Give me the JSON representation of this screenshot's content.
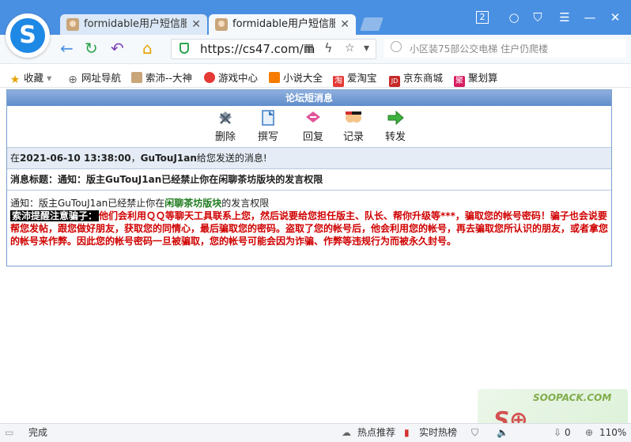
{
  "browser": {
    "tabs": [
      {
        "title": "formidable用户短信服务",
        "close": "✕",
        "active": false
      },
      {
        "title": "formidable用户短信服务",
        "close": "✕",
        "active": true
      }
    ],
    "window_controls": {
      "count": "2",
      "tshirt": "👕",
      "menu": "☰",
      "minimize": "—",
      "maximize": "☐",
      "close": "✕"
    },
    "nav": {
      "back": "←",
      "reload": "↻",
      "undo": "↶",
      "home": "⌂"
    },
    "address": {
      "url": "https://cs47.com/m",
      "qr": "▦",
      "bolt": "ϟ",
      "dropdown": "▾"
    },
    "search": {
      "placeholder": "小区装75部公交电梯 住户仍爬楼"
    }
  },
  "bookmarks": [
    {
      "label": "收藏",
      "icon": "star-icon"
    },
    {
      "label": "网址导航",
      "icon": "globe-icon"
    },
    {
      "label": "索沛--大神",
      "icon": "avatar-icon"
    },
    {
      "label": "游戏中心",
      "icon": "game-icon"
    },
    {
      "label": "小说大全",
      "icon": "book-icon"
    },
    {
      "label": "爱淘宝",
      "icon": "taobao-icon"
    },
    {
      "label": "京东商城",
      "icon": "jd-icon"
    },
    {
      "label": "聚划算",
      "icon": "juhuasuan-icon"
    }
  ],
  "bookmark_glyphs": {
    "taobao": "淘",
    "jd": "JD",
    "ju": "聚",
    "star": "★",
    "globe": "⊕"
  },
  "message": {
    "header": "论坛短消息",
    "tools": [
      {
        "label": "删除",
        "icon": "delete-icon"
      },
      {
        "label": "撰写",
        "icon": "compose-icon"
      },
      {
        "label": "回复",
        "icon": "reply-icon"
      },
      {
        "label": "记录",
        "icon": "record-icon"
      },
      {
        "label": "转发",
        "icon": "forward-icon"
      }
    ],
    "info_prefix": "在",
    "info_time": "2021-06-10 13:38:00",
    "info_sep": "，",
    "info_user": "GuTouJ1an",
    "info_suffix": "给您发送的消息!",
    "subject_label": "消息标题：",
    "subject": "通知：版主GuTouJ1an已经禁止你在闲聊茶坊版块的发言权限",
    "body_prefix": "通知：版主GuTouJ1an已经禁止你在",
    "body_forum": "闲聊茶坊版块",
    "body_suffix": "的发言权限",
    "warning_label": "索沛提醒注意骗子：",
    "warning_text": "他们会利用ＱＱ等聊天工具联系上您，然后说要给您担任版主、队长、帮你升级等***，骗取您的帐号密码！骗子也会说要帮您发帖，跟您做好朋友，获取您的同情心，最后骗取您的密码。盗取了您的帐号后，他会利用您的帐号，再去骗取您所认识的朋友，或者拿您的帐号来作弊。因此您的帐号密码一旦被骗取，您的帐号可能会因为诈骗、作弊等违规行为而被永久封号。"
  },
  "status": {
    "done": "完成",
    "hot": "热点推荐",
    "realtime": "实时热榜",
    "download": "0",
    "zoom": "110%"
  },
  "watermark": {
    "small": "SOOPACK.COM"
  }
}
